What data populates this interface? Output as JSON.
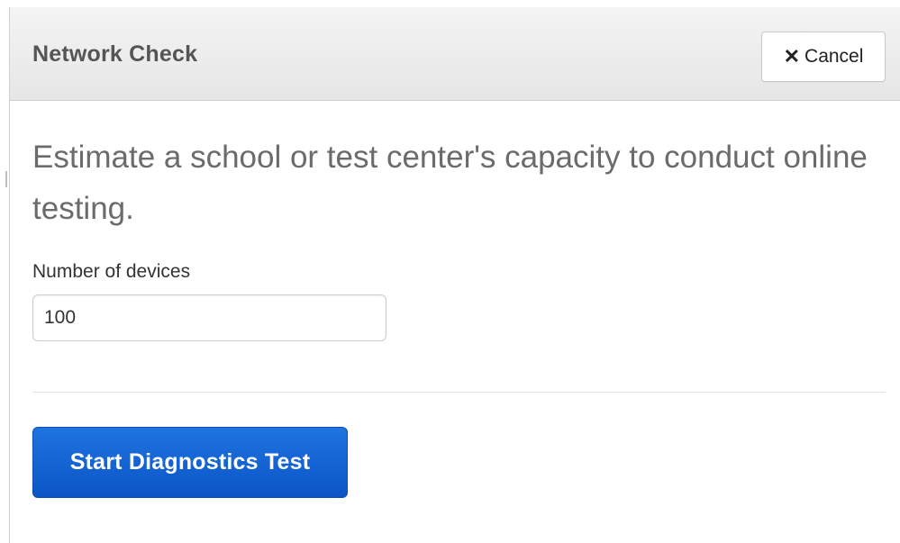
{
  "dialog": {
    "title": "Network Check",
    "cancel_button": {
      "icon": "close-icon",
      "label": "Cancel"
    },
    "description": "Estimate a school or test center's capacity to conduct online testing.",
    "devices_field": {
      "label": "Number of devices",
      "value": "100"
    },
    "start_button": {
      "label": "Start Diagnostics Test"
    }
  },
  "colors": {
    "header_bg": "#ececec",
    "title_text": "#555555",
    "description_text": "#6b6b6b",
    "primary_button": "#0b55c7",
    "primary_button_text": "#ffffff"
  }
}
